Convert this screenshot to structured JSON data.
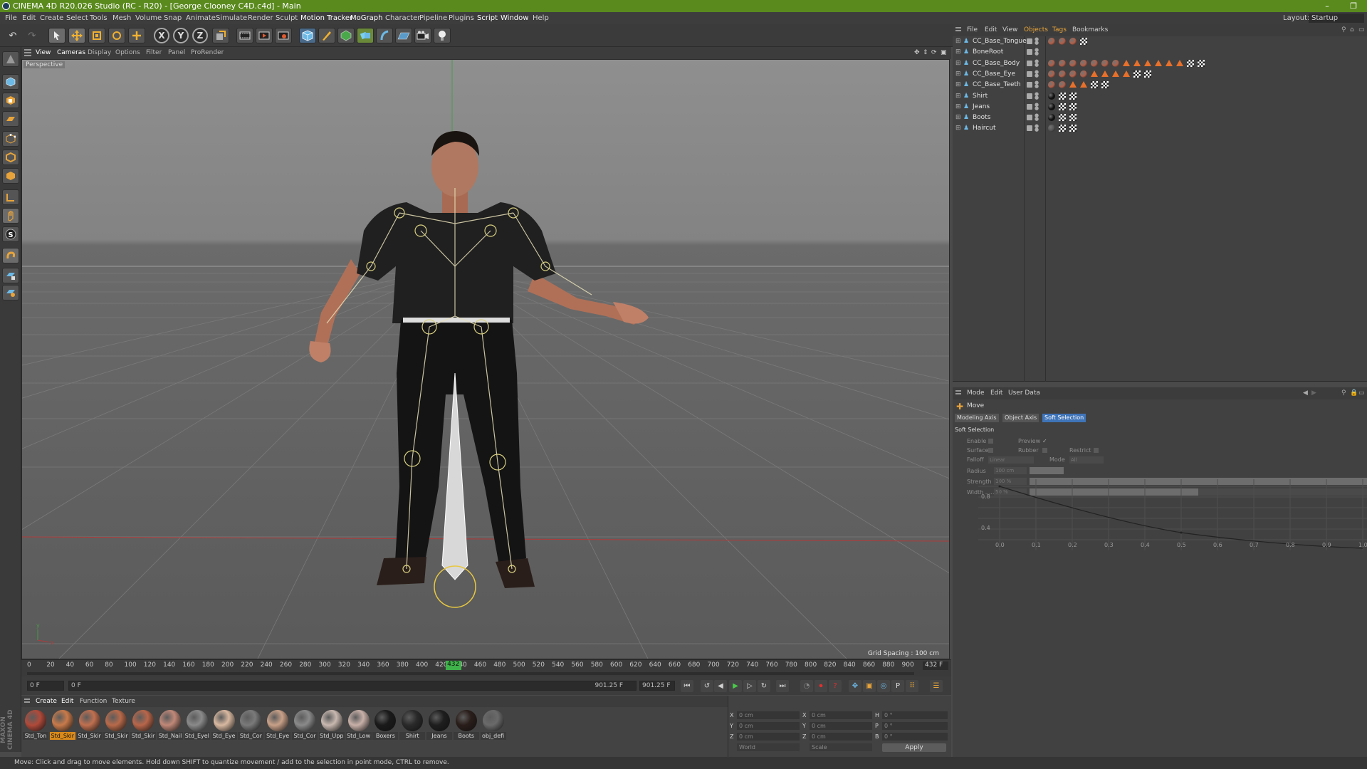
{
  "window": {
    "title": "CINEMA 4D R20.026 Studio (RC - R20) - [George Clooney C4D.c4d] - Main",
    "minimize": "–",
    "maximize": "❐",
    "layout_label": "Layout:",
    "layout_value": "Startup"
  },
  "menu": [
    "File",
    "Edit",
    "Create",
    "Select",
    "Tools",
    "Mesh",
    "Volume",
    "Snap",
    "Animate",
    "Simulate",
    "Render",
    "Sculpt",
    "Motion Tracker",
    "MoGraph",
    "Character",
    "Pipeline",
    "Plugins",
    "Script",
    "Window",
    "Help"
  ],
  "toolbar": {
    "undo": "↶",
    "redo": "↷",
    "axis_x": "X",
    "axis_y": "Y",
    "axis_z": "Z"
  },
  "viewport": {
    "menu": [
      "View",
      "Cameras",
      "Display",
      "Options",
      "Filter",
      "Panel",
      "ProRender"
    ],
    "camera_label": "Perspective",
    "grid_spacing": "Grid Spacing : 100 cm",
    "axis_y": "y",
    "axis_x": "x"
  },
  "timeline": {
    "ticks": [
      "0",
      "20",
      "40",
      "60",
      "80",
      "100",
      "120",
      "140",
      "160",
      "180",
      "200",
      "220",
      "240",
      "260",
      "280",
      "300",
      "320",
      "340",
      "360",
      "380",
      "400",
      "420",
      "440",
      "460",
      "480",
      "500",
      "520",
      "540",
      "560",
      "580",
      "600",
      "620",
      "640",
      "660",
      "680",
      "700",
      "720",
      "740",
      "760",
      "780",
      "800",
      "820",
      "840",
      "860",
      "880",
      "900"
    ],
    "current_frame": "432",
    "current_frame_field": "432 F",
    "start_field": "0 F",
    "range_start": "0 F",
    "range_end": "901.25 F",
    "end_field": "901.25 F"
  },
  "materials": {
    "menu": [
      "Create",
      "Edit",
      "Function",
      "Texture"
    ],
    "items": [
      {
        "name": "Std_Ton",
        "color": "#b04a3a",
        "sel": false
      },
      {
        "name": "Std_Skir",
        "color": "#c87a4a",
        "sel": true
      },
      {
        "name": "Std_Skir",
        "color": "#c07050",
        "sel": false
      },
      {
        "name": "Std_Skir",
        "color": "#b86a4a",
        "sel": false
      },
      {
        "name": "Std_Skir",
        "color": "#b8664a",
        "sel": false
      },
      {
        "name": "Std_Nail",
        "color": "#c08878",
        "sel": false
      },
      {
        "name": "Std_Eyel",
        "color": "#8a8a8a",
        "sel": false
      },
      {
        "name": "Std_Eye",
        "color": "#d8b8a0",
        "sel": false
      },
      {
        "name": "Std_Cor",
        "color": "#7a7a7a",
        "sel": false
      },
      {
        "name": "Std_Eye",
        "color": "#c8a088",
        "sel": false
      },
      {
        "name": "Std_Cor",
        "color": "#8a8a8a",
        "sel": false
      },
      {
        "name": "Std_Upp",
        "color": "#c8b8b0",
        "sel": false
      },
      {
        "name": "Std_Low",
        "color": "#c8b0a8",
        "sel": false
      },
      {
        "name": "Boxers",
        "color": "#1a1a1a",
        "sel": false
      },
      {
        "name": "Shirt",
        "color": "#2a2a2a",
        "sel": false
      },
      {
        "name": "Jeans",
        "color": "#1e1e1e",
        "sel": false
      },
      {
        "name": "Boots",
        "color": "#2a1e1a",
        "sel": false
      },
      {
        "name": "obj_defi",
        "color": "#6a6a6a",
        "sel": false
      }
    ]
  },
  "coords": {
    "x": "X",
    "y": "Y",
    "z": "Z",
    "h": "H",
    "p": "P",
    "b": "B",
    "pos_x": "0 cm",
    "pos_y": "0 cm",
    "pos_z": "0 cm",
    "size_x": "0 cm",
    "size_y": "0 cm",
    "size_z": "0 cm",
    "rot_h": "0 °",
    "rot_p": "0 °",
    "rot_b": "0 °",
    "space": "World",
    "mode": "Scale",
    "apply": "Apply"
  },
  "object_manager": {
    "menu": [
      "File",
      "Edit",
      "View",
      "Objects",
      "Tags",
      "Bookmarks"
    ],
    "objects": [
      {
        "name": "CC_Base_Tongue"
      },
      {
        "name": "BoneRoot"
      },
      {
        "name": "CC_Base_Body"
      },
      {
        "name": "CC_Base_Eye"
      },
      {
        "name": "CC_Base_Teeth"
      },
      {
        "name": "Shirt"
      },
      {
        "name": "Jeans"
      },
      {
        "name": "Boots"
      },
      {
        "name": "Haircut"
      }
    ]
  },
  "attribute_manager": {
    "menu": [
      "Mode",
      "Edit",
      "User Data"
    ],
    "tool_name": "Move",
    "tabs": [
      "Modeling Axis",
      "Object Axis",
      "Soft Selection"
    ],
    "active_tab": "Soft Selection",
    "section": "Soft Selection",
    "enable_label": "Enable",
    "preview_label": "Preview",
    "preview_check": "✓",
    "surface_label": "Surface",
    "rubber_label": "Rubber",
    "restrict_label": "Restrict",
    "falloff_label": "Falloff",
    "falloff_value": "Linear",
    "mode_label": "Mode",
    "mode_value": "All",
    "radius_label": "Radius",
    "radius_value": "100 cm",
    "strength_label": "Strength",
    "strength_value": "100 %",
    "width_label": "Width .....",
    "width_value": "50 %",
    "width_fraction": 0.5,
    "graph_y_ticks": [
      "0.8",
      "0.4"
    ],
    "graph_x_ticks": [
      "0.0",
      "0.1",
      "0.2",
      "0.3",
      "0.4",
      "0.5",
      "0.6",
      "0.7",
      "0.8",
      "0.9",
      "1.0"
    ]
  },
  "status_text": "Move: Click and drag to move elements. Hold down SHIFT to quantize movement / add to the selection in point mode, CTRL to remove.",
  "maxon_logo": "MAXON CINEMA 4D"
}
